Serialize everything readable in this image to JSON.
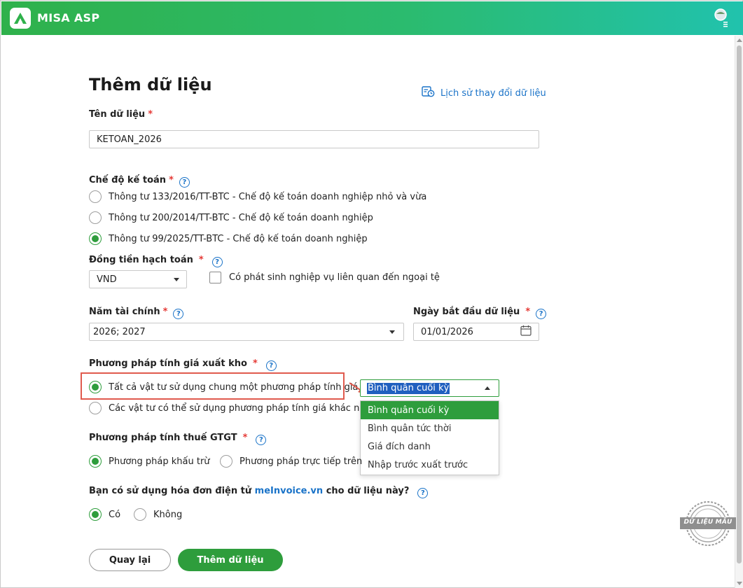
{
  "app": {
    "name": "MISA ASP"
  },
  "page": {
    "title": "Thêm dữ liệu",
    "history_link": "Lịch sử thay đổi dữ liệu"
  },
  "data_name": {
    "label": "Tên dữ liệu",
    "required": "*",
    "value": "KETOAN_2026"
  },
  "accounting_regime": {
    "label": "Chế độ kế toán",
    "required": "*",
    "options": [
      {
        "label": "Thông tư 133/2016/TT-BTC - Chế độ kế toán doanh nghiệp nhỏ và vừa",
        "selected": false
      },
      {
        "label": "Thông tư 200/2014/TT-BTC - Chế độ kế toán doanh nghiệp",
        "selected": false
      },
      {
        "label": "Thông tư 99/2025/TT-BTC - Chế độ kế toán doanh nghiệp",
        "selected": true
      }
    ]
  },
  "currency": {
    "label": "Đồng tiền hạch toán",
    "required": "*",
    "value": "VND",
    "foreign_checkbox_label": "Có phát sinh nghiệp vụ liên quan đến ngoại tệ",
    "foreign_checked": false
  },
  "fiscal_year": {
    "label": "Năm tài chính",
    "required": "*",
    "value": "2026; 2027"
  },
  "start_date": {
    "label": "Ngày bắt đầu dữ liệu",
    "required": "*",
    "value": "01/01/2026"
  },
  "inventory_method": {
    "label": "Phương pháp tính giá xuất kho",
    "required": "*",
    "options": [
      {
        "label": "Tất cả vật tư sử dụng chung một phương pháp tính giá",
        "selected": true
      },
      {
        "label": "Các vật tư có thể sử dụng phương pháp tính giá khác nhau",
        "selected": false
      }
    ],
    "combo_value": "Bình quân cuối kỳ",
    "dropdown_items": [
      "Bình quân cuối kỳ",
      "Bình quân tức thời",
      "Giá đích danh",
      "Nhập trước xuất trước"
    ]
  },
  "vat_method": {
    "label": "Phương pháp tính thuế GTGT",
    "required": "*",
    "options": [
      {
        "label": "Phương pháp khấu trừ",
        "selected": true
      },
      {
        "label": "Phương pháp trực tiếp trên",
        "selected": false
      }
    ]
  },
  "einvoice": {
    "label_prefix": "Bạn có sử dụng hóa đơn điện tử ",
    "label_link": "meInvoice.vn",
    "label_suffix": " cho dữ liệu này?",
    "options": [
      {
        "label": "Có",
        "selected": true
      },
      {
        "label": "Không",
        "selected": false
      }
    ]
  },
  "buttons": {
    "back": "Quay lại",
    "add": "Thêm dữ liệu"
  },
  "stamp": {
    "text": "DỮ LIỆU MẪU"
  },
  "help_glyph": "?",
  "colors": {
    "brand_green": "#2e9d3c",
    "link_blue": "#1a73c8",
    "required_red": "#e53935",
    "highlight_red": "#e05a4e"
  }
}
